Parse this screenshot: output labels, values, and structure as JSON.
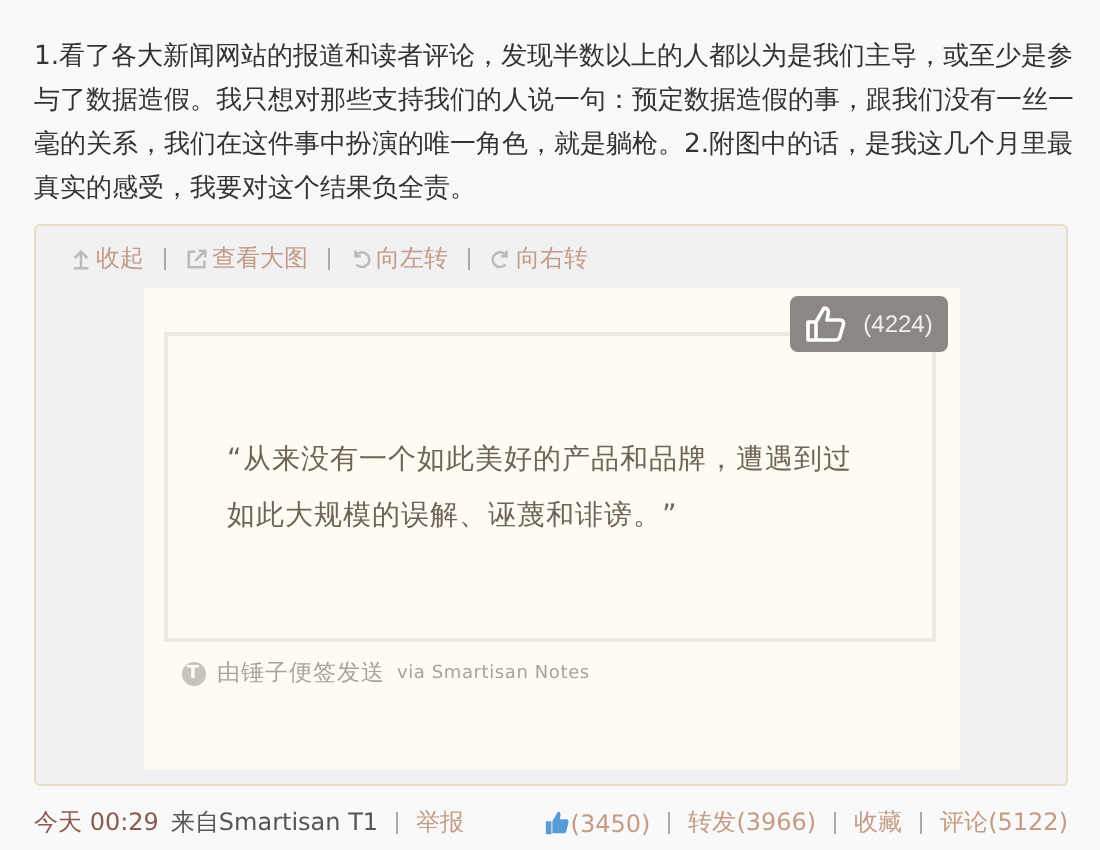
{
  "post": {
    "text": "1.看了各大新闻网站的报道和读者评论，发现半数以上的人都以为是我们主导，或至少是参与了数据造假。我只想对那些支持我们的人说一句：预定数据造假的事，跟我们没有一丝一毫的关系，我们在这件事中扮演的唯一角色，就是躺枪。2.附图中的话，是我这几个月里最真实的感受，我要对这个结果负全责。"
  },
  "image_toolbar": [
    {
      "kind": "collapse",
      "label": "收起"
    },
    {
      "kind": "open",
      "label": "查看大图"
    },
    {
      "kind": "rotate-left",
      "label": "向左转"
    },
    {
      "kind": "rotate-right",
      "label": "向右转"
    }
  ],
  "note": {
    "likes": "(4224)",
    "quote": "“从来没有一个如此美好的产品和品牌，遭遇到过如此大规模的误解、诬蔑和诽谤。”",
    "footer_icon": "T",
    "footer": "由锤子便签发送",
    "footer_via": "via Smartisan Notes"
  },
  "meta": {
    "time": "今天 00:29",
    "source": "来自Smartisan T1",
    "report": "举报"
  },
  "actions": [
    {
      "kind": "like",
      "label": "(3450)"
    },
    {
      "kind": "text",
      "label": "转发(3966)"
    },
    {
      "kind": "text",
      "label": "收藏"
    },
    {
      "kind": "text",
      "label": "评论(5122)"
    }
  ]
}
